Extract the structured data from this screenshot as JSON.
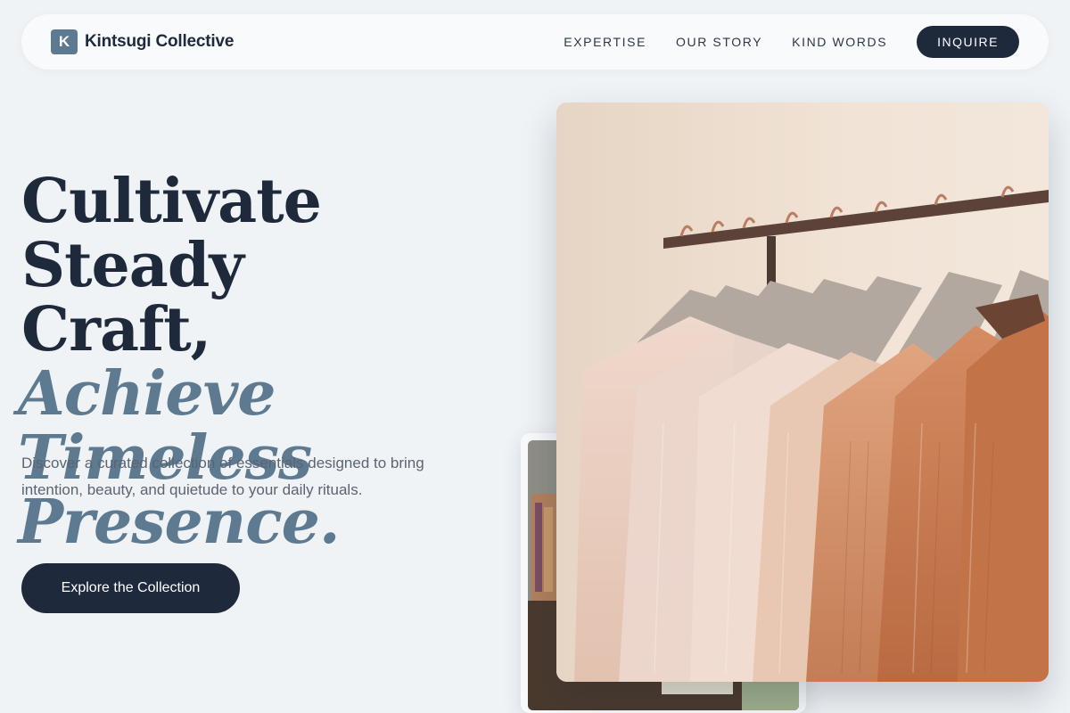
{
  "brand": {
    "mark": "K",
    "name": "Kintsugi Collective"
  },
  "nav": {
    "links": [
      "EXPERTISE",
      "OUR STORY",
      "KIND WORDS"
    ],
    "cta": "INQUIRE"
  },
  "hero": {
    "line1": "Cultivate Steady",
    "line2": "Craft,",
    "line3": "Achieve Timeless",
    "line4": "Presence.",
    "lede": "Discover a curated collection of essentials designed to bring intention, beauty, and quietude to your daily rituals.",
    "cta": "Explore the Collection"
  },
  "colors": {
    "background": "#eff3f6",
    "navy": "#1e293b",
    "slate_accent": "#5d7a90"
  },
  "images": {
    "main_photo": "clothing-rack-photo",
    "thumb_photo": "boutique-interior-photo"
  }
}
